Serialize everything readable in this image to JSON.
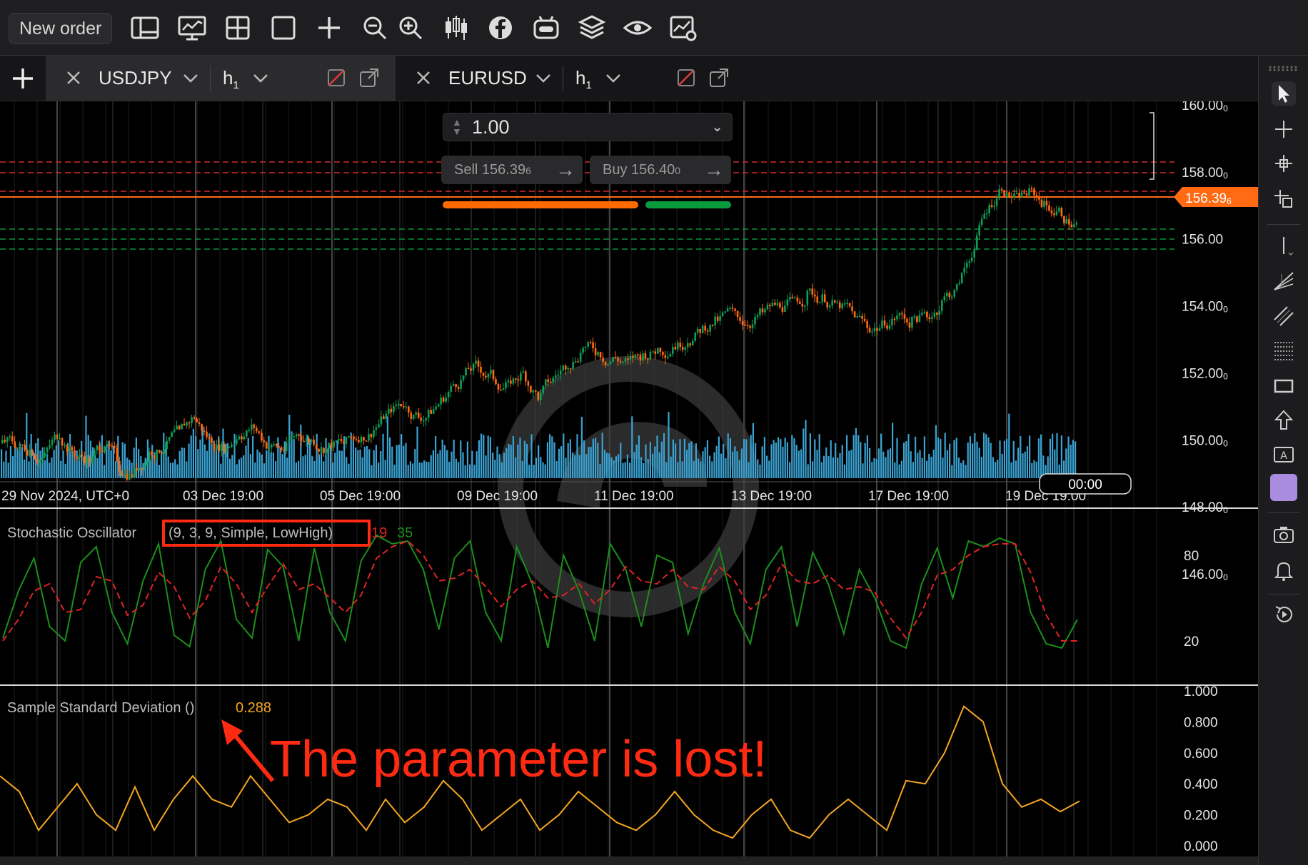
{
  "toolbar": {
    "new_order_label": "New order",
    "icons": [
      "layout-icon",
      "monitor-chart-icon",
      "grid-icon",
      "square-icon",
      "plus-icon",
      "zoom-out-icon",
      "zoom-in-icon",
      "candlestick-icon",
      "facebook-icon",
      "robot-icon",
      "layers-icon",
      "eye-icon",
      "chart-settings-icon"
    ]
  },
  "tabs": [
    {
      "symbol": "USDJPY",
      "timeframe": "h",
      "timeframe_sub": "1",
      "active": true
    },
    {
      "symbol": "EURUSD",
      "timeframe": "h",
      "timeframe_sub": "1",
      "active": false
    }
  ],
  "order_panel": {
    "quantity": "1.00",
    "sell_label": "Sell 156.39",
    "sell_pip": "6",
    "buy_label": "Buy 156.40",
    "buy_pip": "0",
    "sell_share": 0.7
  },
  "price_axis": {
    "labels": [
      "160.00",
      "158.00",
      "154.00",
      "152.00",
      "150.00",
      "148.00",
      "146.00"
    ],
    "label_suffix": "0",
    "partial_label": "156.00",
    "current_price": "156.39",
    "current_price_pip": "6"
  },
  "time_axis": {
    "labels": [
      "29 Nov 2024, UTC+0",
      "03 Dec 19:00",
      "05 Dec 19:00",
      "09 Dec 19:00",
      "11 Dec 19:00",
      "13 Dec 19:00",
      "17 Dec 19:00",
      "19 Dec 19:00"
    ],
    "crosshair_time": "00:00"
  },
  "indicators": {
    "stochastic": {
      "name": "Stochastic Oscillator",
      "params": "(9, 3, 9, Simple, LowHigh)",
      "value_k": "19",
      "value_d": "35",
      "axis_labels": [
        "80",
        "20"
      ]
    },
    "stddev": {
      "name": "Sample Standard Deviation ()",
      "value": "0.288",
      "axis_labels": [
        "1.000",
        "0.800",
        "0.600",
        "0.400",
        "0.200",
        "0.000"
      ]
    }
  },
  "annotation": {
    "text": "The parameter is lost!"
  },
  "colors": {
    "bull": "#0f9d58",
    "bear": "#ff6a13",
    "volume": "#3aa3d4",
    "stoch_k": "#1b8f1b",
    "stoch_d": "#e02424",
    "stddev": "#f5a623",
    "highlight": "#ff2a12",
    "sell": "#ff6a00",
    "buy": "#0a9b3f"
  },
  "chart_data": [
    {
      "type": "candlestick",
      "symbol": "USDJPY",
      "timeframe": "h1",
      "title": "",
      "ylim": [
        146.0,
        160.0
      ],
      "x_labels": [
        "29 Nov 2024, UTC+0",
        "03 Dec 19:00",
        "05 Dec 19:00",
        "09 Dec 19:00",
        "11 Dec 19:00",
        "13 Dec 19:00",
        "17 Dec 19:00",
        "19 Dec 19:00"
      ],
      "close_series": [
        149.9,
        149.7,
        149.5,
        150.2,
        149.6,
        149.4,
        149.9,
        149.2,
        149.0,
        149.6,
        149.8,
        150.2,
        150.7,
        150.0,
        149.8,
        150.2,
        150.4,
        149.8,
        149.7,
        150.2,
        150.0,
        149.8,
        149.9,
        150.1,
        150.3,
        150.8,
        151.1,
        150.7,
        150.9,
        151.4,
        151.9,
        152.2,
        151.9,
        151.6,
        152.0,
        151.3,
        151.8,
        152.3,
        152.8,
        152.6,
        152.4,
        152.3,
        152.5,
        152.7,
        152.8,
        153.0,
        153.3,
        153.6,
        153.8,
        153.5,
        153.8,
        154.0,
        154.1,
        154.3,
        154.2,
        154.0,
        153.8,
        153.4,
        153.4,
        153.7,
        153.5,
        153.7,
        154.1,
        154.5,
        155.6,
        156.9,
        157.6,
        157.2,
        157.4,
        157.0,
        156.8,
        156.4
      ]
    },
    {
      "type": "line",
      "name": "Stochastic Oscillator",
      "ylim": [
        0,
        100
      ],
      "series": [
        {
          "name": "%K",
          "values": [
            22,
            55,
            78,
            30,
            20,
            75,
            86,
            40,
            18,
            62,
            88,
            24,
            16,
            70,
            90,
            35,
            22,
            84,
            72,
            20,
            85,
            40,
            20,
            76,
            94,
            88,
            90,
            70,
            28,
            78,
            90,
            40,
            20,
            86,
            60,
            15,
            80,
            55,
            20,
            88,
            70,
            30,
            80,
            75,
            25,
            60,
            85,
            40,
            18,
            70,
            86,
            30,
            82,
            60,
            25,
            70,
            50,
            20,
            15,
            60,
            85,
            50,
            90,
            86,
            92,
            88,
            40,
            18,
            15,
            35
          ]
        },
        {
          "name": "%D",
          "values": [
            20,
            35,
            55,
            60,
            40,
            42,
            65,
            62,
            38,
            45,
            68,
            58,
            36,
            48,
            72,
            60,
            40,
            58,
            74,
            56,
            60,
            50,
            40,
            52,
            78,
            86,
            90,
            80,
            62,
            64,
            70,
            58,
            44,
            56,
            62,
            50,
            52,
            60,
            46,
            56,
            72,
            62,
            60,
            70,
            58,
            56,
            72,
            62,
            42,
            52,
            74,
            62,
            60,
            66,
            56,
            58,
            54,
            36,
            22,
            40,
            66,
            70,
            80,
            86,
            88,
            88,
            68,
            38,
            20,
            20
          ]
        }
      ]
    },
    {
      "type": "line",
      "name": "Sample Standard Deviation",
      "ylim": [
        0,
        1.0
      ],
      "series": [
        {
          "name": "",
          "values": [
            0.45,
            0.35,
            0.1,
            0.25,
            0.4,
            0.2,
            0.1,
            0.38,
            0.1,
            0.3,
            0.45,
            0.3,
            0.25,
            0.45,
            0.3,
            0.15,
            0.2,
            0.3,
            0.25,
            0.1,
            0.3,
            0.15,
            0.25,
            0.42,
            0.3,
            0.1,
            0.2,
            0.3,
            0.1,
            0.2,
            0.35,
            0.25,
            0.15,
            0.1,
            0.2,
            0.35,
            0.2,
            0.1,
            0.05,
            0.2,
            0.3,
            0.1,
            0.05,
            0.2,
            0.3,
            0.2,
            0.1,
            0.42,
            0.4,
            0.6,
            0.9,
            0.8,
            0.4,
            0.25,
            0.3,
            0.22,
            0.288
          ]
        }
      ]
    }
  ]
}
